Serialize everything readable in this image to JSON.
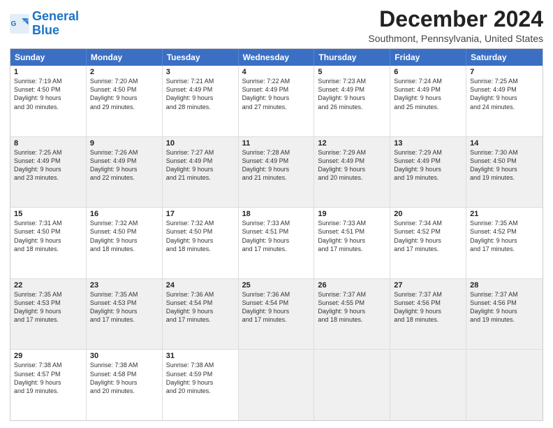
{
  "header": {
    "logo_line1": "General",
    "logo_line2": "Blue",
    "month_title": "December 2024",
    "subtitle": "Southmont, Pennsylvania, United States"
  },
  "weekdays": [
    "Sunday",
    "Monday",
    "Tuesday",
    "Wednesday",
    "Thursday",
    "Friday",
    "Saturday"
  ],
  "rows": [
    [
      {
        "day": "1",
        "lines": [
          "Sunrise: 7:19 AM",
          "Sunset: 4:50 PM",
          "Daylight: 9 hours",
          "and 30 minutes."
        ],
        "shaded": false
      },
      {
        "day": "2",
        "lines": [
          "Sunrise: 7:20 AM",
          "Sunset: 4:50 PM",
          "Daylight: 9 hours",
          "and 29 minutes."
        ],
        "shaded": false
      },
      {
        "day": "3",
        "lines": [
          "Sunrise: 7:21 AM",
          "Sunset: 4:49 PM",
          "Daylight: 9 hours",
          "and 28 minutes."
        ],
        "shaded": false
      },
      {
        "day": "4",
        "lines": [
          "Sunrise: 7:22 AM",
          "Sunset: 4:49 PM",
          "Daylight: 9 hours",
          "and 27 minutes."
        ],
        "shaded": false
      },
      {
        "day": "5",
        "lines": [
          "Sunrise: 7:23 AM",
          "Sunset: 4:49 PM",
          "Daylight: 9 hours",
          "and 26 minutes."
        ],
        "shaded": false
      },
      {
        "day": "6",
        "lines": [
          "Sunrise: 7:24 AM",
          "Sunset: 4:49 PM",
          "Daylight: 9 hours",
          "and 25 minutes."
        ],
        "shaded": false
      },
      {
        "day": "7",
        "lines": [
          "Sunrise: 7:25 AM",
          "Sunset: 4:49 PM",
          "Daylight: 9 hours",
          "and 24 minutes."
        ],
        "shaded": false
      }
    ],
    [
      {
        "day": "8",
        "lines": [
          "Sunrise: 7:25 AM",
          "Sunset: 4:49 PM",
          "Daylight: 9 hours",
          "and 23 minutes."
        ],
        "shaded": true
      },
      {
        "day": "9",
        "lines": [
          "Sunrise: 7:26 AM",
          "Sunset: 4:49 PM",
          "Daylight: 9 hours",
          "and 22 minutes."
        ],
        "shaded": true
      },
      {
        "day": "10",
        "lines": [
          "Sunrise: 7:27 AM",
          "Sunset: 4:49 PM",
          "Daylight: 9 hours",
          "and 21 minutes."
        ],
        "shaded": true
      },
      {
        "day": "11",
        "lines": [
          "Sunrise: 7:28 AM",
          "Sunset: 4:49 PM",
          "Daylight: 9 hours",
          "and 21 minutes."
        ],
        "shaded": true
      },
      {
        "day": "12",
        "lines": [
          "Sunrise: 7:29 AM",
          "Sunset: 4:49 PM",
          "Daylight: 9 hours",
          "and 20 minutes."
        ],
        "shaded": true
      },
      {
        "day": "13",
        "lines": [
          "Sunrise: 7:29 AM",
          "Sunset: 4:49 PM",
          "Daylight: 9 hours",
          "and 19 minutes."
        ],
        "shaded": true
      },
      {
        "day": "14",
        "lines": [
          "Sunrise: 7:30 AM",
          "Sunset: 4:50 PM",
          "Daylight: 9 hours",
          "and 19 minutes."
        ],
        "shaded": true
      }
    ],
    [
      {
        "day": "15",
        "lines": [
          "Sunrise: 7:31 AM",
          "Sunset: 4:50 PM",
          "Daylight: 9 hours",
          "and 18 minutes."
        ],
        "shaded": false
      },
      {
        "day": "16",
        "lines": [
          "Sunrise: 7:32 AM",
          "Sunset: 4:50 PM",
          "Daylight: 9 hours",
          "and 18 minutes."
        ],
        "shaded": false
      },
      {
        "day": "17",
        "lines": [
          "Sunrise: 7:32 AM",
          "Sunset: 4:50 PM",
          "Daylight: 9 hours",
          "and 18 minutes."
        ],
        "shaded": false
      },
      {
        "day": "18",
        "lines": [
          "Sunrise: 7:33 AM",
          "Sunset: 4:51 PM",
          "Daylight: 9 hours",
          "and 17 minutes."
        ],
        "shaded": false
      },
      {
        "day": "19",
        "lines": [
          "Sunrise: 7:33 AM",
          "Sunset: 4:51 PM",
          "Daylight: 9 hours",
          "and 17 minutes."
        ],
        "shaded": false
      },
      {
        "day": "20",
        "lines": [
          "Sunrise: 7:34 AM",
          "Sunset: 4:52 PM",
          "Daylight: 9 hours",
          "and 17 minutes."
        ],
        "shaded": false
      },
      {
        "day": "21",
        "lines": [
          "Sunrise: 7:35 AM",
          "Sunset: 4:52 PM",
          "Daylight: 9 hours",
          "and 17 minutes."
        ],
        "shaded": false
      }
    ],
    [
      {
        "day": "22",
        "lines": [
          "Sunrise: 7:35 AM",
          "Sunset: 4:53 PM",
          "Daylight: 9 hours",
          "and 17 minutes."
        ],
        "shaded": true
      },
      {
        "day": "23",
        "lines": [
          "Sunrise: 7:35 AM",
          "Sunset: 4:53 PM",
          "Daylight: 9 hours",
          "and 17 minutes."
        ],
        "shaded": true
      },
      {
        "day": "24",
        "lines": [
          "Sunrise: 7:36 AM",
          "Sunset: 4:54 PM",
          "Daylight: 9 hours",
          "and 17 minutes."
        ],
        "shaded": true
      },
      {
        "day": "25",
        "lines": [
          "Sunrise: 7:36 AM",
          "Sunset: 4:54 PM",
          "Daylight: 9 hours",
          "and 17 minutes."
        ],
        "shaded": true
      },
      {
        "day": "26",
        "lines": [
          "Sunrise: 7:37 AM",
          "Sunset: 4:55 PM",
          "Daylight: 9 hours",
          "and 18 minutes."
        ],
        "shaded": true
      },
      {
        "day": "27",
        "lines": [
          "Sunrise: 7:37 AM",
          "Sunset: 4:56 PM",
          "Daylight: 9 hours",
          "and 18 minutes."
        ],
        "shaded": true
      },
      {
        "day": "28",
        "lines": [
          "Sunrise: 7:37 AM",
          "Sunset: 4:56 PM",
          "Daylight: 9 hours",
          "and 19 minutes."
        ],
        "shaded": true
      }
    ],
    [
      {
        "day": "29",
        "lines": [
          "Sunrise: 7:38 AM",
          "Sunset: 4:57 PM",
          "Daylight: 9 hours",
          "and 19 minutes."
        ],
        "shaded": false
      },
      {
        "day": "30",
        "lines": [
          "Sunrise: 7:38 AM",
          "Sunset: 4:58 PM",
          "Daylight: 9 hours",
          "and 20 minutes."
        ],
        "shaded": false
      },
      {
        "day": "31",
        "lines": [
          "Sunrise: 7:38 AM",
          "Sunset: 4:59 PM",
          "Daylight: 9 hours",
          "and 20 minutes."
        ],
        "shaded": false
      },
      {
        "day": "",
        "lines": [],
        "shaded": true,
        "empty": true
      },
      {
        "day": "",
        "lines": [],
        "shaded": true,
        "empty": true
      },
      {
        "day": "",
        "lines": [],
        "shaded": true,
        "empty": true
      },
      {
        "day": "",
        "lines": [],
        "shaded": true,
        "empty": true
      }
    ]
  ]
}
